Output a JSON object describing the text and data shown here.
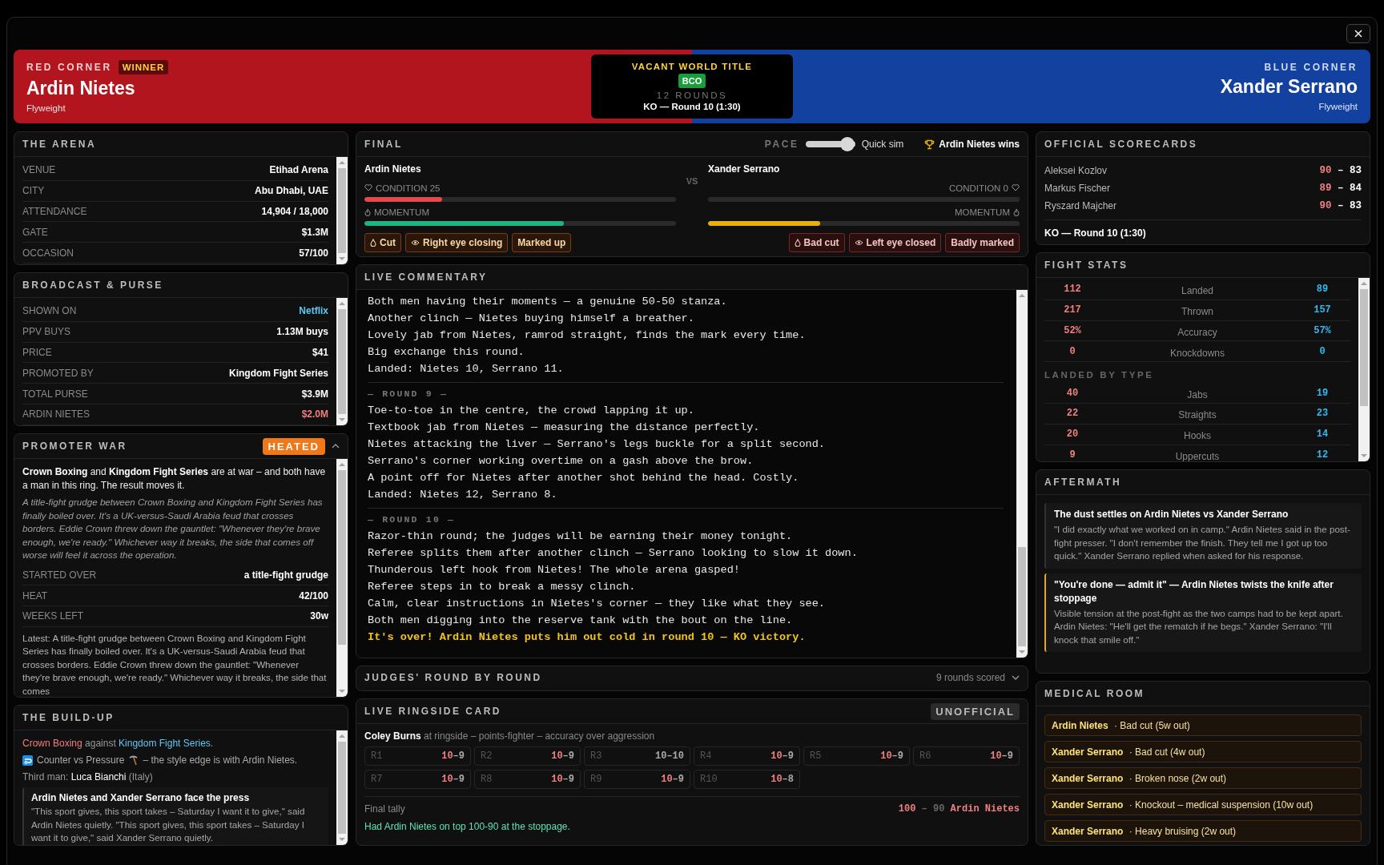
{
  "banner": {
    "red_corner": {
      "label": "RED CORNER",
      "badge": "WINNER",
      "name": "Ardin Nietes",
      "division": "Flyweight"
    },
    "title_card": {
      "title": "VACANT WORLD TITLE",
      "belt": "BCO",
      "rounds": "12 ROUNDS",
      "result": "KO — Round 10 (1:30)"
    },
    "blue_corner": {
      "label": "BLUE CORNER",
      "name": "Xander Serrano",
      "division": "Flyweight"
    }
  },
  "arena": {
    "title": "THE ARENA",
    "rows": [
      {
        "label": "VENUE",
        "value": "Etihad Arena"
      },
      {
        "label": "CITY",
        "value": "Abu Dhabi, UAE"
      },
      {
        "label": "ATTENDANCE",
        "value": "14,904 / 18,000"
      },
      {
        "label": "GATE",
        "value": "$1.3M"
      },
      {
        "label": "OCCASION",
        "value": "57/100"
      }
    ]
  },
  "broadcast": {
    "title": "BROADCAST & PURSE",
    "rows": [
      {
        "label": "SHOWN ON",
        "value": "Netflix",
        "kind": "link"
      },
      {
        "label": "PPV BUYS",
        "value": "1.13M buys",
        "kind": "plain"
      },
      {
        "label": "PRICE",
        "value": "$41",
        "kind": "plain"
      },
      {
        "label": "PROMOTED BY",
        "value": "Kingdom Fight Series",
        "kind": "plain"
      },
      {
        "label": "TOTAL PURSE",
        "value": "$3.9M",
        "kind": "plain"
      },
      {
        "label": "ARDIN NIETES",
        "value": "$2.0M",
        "kind": "red"
      }
    ]
  },
  "promoter_war": {
    "title": "PROMOTER WAR",
    "badge": "HEATED",
    "expanded": true,
    "intro": "**Crown Boxing** and **Kingdom Fight Series** are at war – and both have a man in this ring. The result moves it.",
    "story": "A title-fight grudge between Crown Boxing and Kingdom Fight Series has finally boiled over. It's a UK-versus-Saudi Arabia feud that crosses borders. Eddie Crown threw down the gauntlet: \"Whenever they're brave enough, we're ready.\" Whichever way it breaks, the side that comes off worse will feel it across the operation.",
    "rows": [
      {
        "label": "STARTED OVER",
        "value": "a title-fight grudge"
      },
      {
        "label": "HEAT",
        "value": "42/100"
      },
      {
        "label": "WEEKS LEFT",
        "value": "30w"
      }
    ],
    "latest": "Latest: A title-fight grudge between Crown Boxing and Kingdom Fight Series has finally boiled over. It's a UK-versus-Saudi Arabia feud that crosses borders. Eddie Crown threw down the gauntlet: \"Whenever they're brave enough, we're ready.\" Whichever way it breaks, the side that comes"
  },
  "build_up": {
    "title": "THE BUILD-UP",
    "rivalry": {
      "red": "Crown Boxing",
      "joiner": "against",
      "blue": "Kingdom Fight Series",
      "end": "."
    },
    "style_line": {
      "left": "Counter vs Pressure",
      "right": "– the style edge is with Ardin Nietes."
    },
    "third_man": "Third man: **Luca Bianchi** (Italy)",
    "press": {
      "title": "Ardin Nietes and Xander Serrano face the press",
      "text": "\"This sport gives, this sport takes – Saturday I want it to give,\" said Ardin Nietes quietly. \"This sport gives, this sport takes – Saturday I want it to give,\" said Xander Serrano quietly."
    }
  },
  "final": {
    "status": "FINAL",
    "pace": {
      "label": "PACE",
      "level": 1,
      "value": "Quick sim"
    },
    "winner": "Ardin Nietes wins",
    "vs": "VS",
    "fighters": [
      {
        "kind": "red",
        "name": "Ardin Nietes",
        "condition": {
          "label": "CONDITION 25",
          "level": 0.25
        },
        "momentum": {
          "label": "MOMENTUM",
          "level": 0.64,
          "color": "#1db584"
        },
        "tags": [
          {
            "label": "Cut",
            "kind": "cut"
          },
          {
            "label": "Right eye closing",
            "kind": "eye"
          },
          {
            "label": "Marked up",
            "kind": "mark"
          }
        ]
      },
      {
        "kind": "blue",
        "name": "Xander Serrano",
        "condition": {
          "label": "CONDITION 0",
          "level": 0
        },
        "momentum": {
          "label": "MOMENTUM",
          "level": 0.36,
          "color": "#e9b10f"
        },
        "tags": [
          {
            "label": "Bad cut",
            "kind": "cut"
          },
          {
            "label": "Left eye closed",
            "kind": "eye"
          },
          {
            "label": "Badly marked",
            "kind": "mark"
          }
        ]
      }
    ]
  },
  "commentary": {
    "title": "LIVE COMMENTARY",
    "sections": [
      {
        "lines": [
          {
            "text": "Both men having their moments — a genuine 50-50 stanza.",
            "kind": "normal"
          },
          {
            "text": "Another clinch — Nietes buying himself a breather.",
            "kind": "normal"
          },
          {
            "text": "Lovely jab from Nietes, ramrod straight, finds the mark every time.",
            "kind": "normal"
          },
          {
            "text": "Big exchange this round.",
            "kind": "normal"
          },
          {
            "text": "Landed: Nietes 10, Serrano 11.",
            "kind": "normal"
          }
        ]
      },
      {
        "heading": "— ROUND 9 —",
        "lines": [
          {
            "text": "Toe-to-toe in the centre, the crowd lapping it up.",
            "kind": "normal"
          },
          {
            "text": "Textbook jab from Nietes — measuring the distance perfectly.",
            "kind": "normal"
          },
          {
            "text": "Nietes attacking the liver — Serrano's legs buckle for a split second.",
            "kind": "normal"
          },
          {
            "text": "Serrano's corner working overtime on a gash above the brow.",
            "kind": "normal"
          },
          {
            "text": "A point off for Nietes after another shot behind the head. Costly.",
            "kind": "normal"
          },
          {
            "text": "Landed: Nietes 12, Serrano 8.",
            "kind": "normal"
          }
        ]
      },
      {
        "heading": "— ROUND 10 —",
        "lines": [
          {
            "text": "Razor-thin round; the judges will be earning their money tonight.",
            "kind": "normal"
          },
          {
            "text": "Referee splits them after another clinch — Serrano looking to slow it down.",
            "kind": "normal"
          },
          {
            "text": "Thunderous left hook from Nietes! The whole arena gasped!",
            "kind": "normal"
          },
          {
            "text": "Referee steps in to break a messy clinch.",
            "kind": "normal"
          },
          {
            "text": "Calm, clear instructions in Nietes's corner — they like what they see.",
            "kind": "normal"
          },
          {
            "text": "Both men digging into the reserve tank with the bout on the line.",
            "kind": "normal"
          },
          {
            "text": "It's over! Ardin Nietes puts him out cold in round 10 — KO victory.",
            "kind": "finish"
          }
        ]
      }
    ]
  },
  "judges": {
    "title": "JUDGES' ROUND BY ROUND",
    "summary": "9 rounds scored",
    "expanded": false
  },
  "ringside_card": {
    "title": "LIVE RINGSIDE CARD",
    "badge": "UNOFFICIAL",
    "judge": "Coley Burns",
    "judge_note": "at ringside – points-fighter – accuracy over aggression",
    "rounds": [
      {
        "round": "R1",
        "red": "10",
        "dash": "–",
        "blue": "9",
        "kind": "won"
      },
      {
        "round": "R2",
        "red": "10",
        "dash": "–",
        "blue": "9",
        "kind": "won"
      },
      {
        "round": "R3",
        "red": "10",
        "dash": "–",
        "blue": "10",
        "kind": "even"
      },
      {
        "round": "R4",
        "red": "10",
        "dash": "–",
        "blue": "9",
        "kind": "won"
      },
      {
        "round": "R5",
        "red": "10",
        "dash": "–",
        "blue": "9",
        "kind": "won"
      },
      {
        "round": "R6",
        "red": "10",
        "dash": "–",
        "blue": "9",
        "kind": "won"
      },
      {
        "round": "R7",
        "red": "10",
        "dash": "–",
        "blue": "9",
        "kind": "won"
      },
      {
        "round": "R8",
        "red": "10",
        "dash": "–",
        "blue": "9",
        "kind": "won"
      },
      {
        "round": "R9",
        "red": "10",
        "dash": "–",
        "blue": "9",
        "kind": "won"
      },
      {
        "round": "R10",
        "red": "10",
        "dash": "–",
        "blue": "8",
        "kind": "won"
      }
    ],
    "tally": {
      "label": "Final tally",
      "red": "100",
      "dash": "–",
      "blue": "90",
      "winner": "Ardin Nietes"
    },
    "note": "Had Ardin Nietes on top 100-90 at the stoppage."
  },
  "scorecards": {
    "title": "OFFICIAL SCORECARDS",
    "judges": [
      {
        "name": "Aleksei Kozlov",
        "red": "90",
        "dash": "–",
        "blue": "83"
      },
      {
        "name": "Markus Fischer",
        "red": "89",
        "dash": "–",
        "blue": "84"
      },
      {
        "name": "Ryszard Majcher",
        "red": "90",
        "dash": "–",
        "blue": "83"
      }
    ],
    "result": "KO — Round 10 (1:30)"
  },
  "fight_stats": {
    "title": "FIGHT STATS",
    "rows": [
      {
        "red": "112",
        "label": "Landed",
        "blue": "89"
      },
      {
        "red": "217",
        "label": "Thrown",
        "blue": "157"
      },
      {
        "red": "52%",
        "label": "Accuracy",
        "blue": "57%"
      },
      {
        "red": "0",
        "label": "Knockdowns",
        "blue": "0"
      }
    ],
    "section": "LANDED BY TYPE",
    "type_rows": [
      {
        "red": "40",
        "label": "Jabs",
        "blue": "19"
      },
      {
        "red": "22",
        "label": "Straights",
        "blue": "23"
      },
      {
        "red": "20",
        "label": "Hooks",
        "blue": "14"
      },
      {
        "red": "9",
        "label": "Uppercuts",
        "blue": "12"
      }
    ]
  },
  "aftermath": {
    "title": "AFTERMATH",
    "items": [
      {
        "title": "The dust settles on Ardin Nietes vs Xander Serrano",
        "text": "\"I did exactly what we worked on in camp.\" Ardin Nietes said in the post-fight presser. \"I don't remember the finish. They tell me I got up too quick.\" Xander Serrano replied when asked for his response.",
        "kind": "neutral"
      },
      {
        "title": "\"You're done — admit it\" — Ardin Nietes twists the knife after stoppage",
        "text": "Visible tension at the post-fight as the two camps had to be kept apart. Ardin Nietes: \"He'll get the rematch if he begs.\" Xander Serrano: \"I'll knock that smile off.\"",
        "kind": "heated"
      }
    ]
  },
  "medical": {
    "title": "MEDICAL ROOM",
    "items": [
      {
        "text": "**Ardin Nietes** · Bad cut (5w out)"
      },
      {
        "text": "**Xander Serrano** · Bad cut (4w out)"
      },
      {
        "text": "**Xander Serrano** · Broken nose (2w out)"
      },
      {
        "text": "**Xander Serrano** · Knockout – medical suspension (10w out)"
      },
      {
        "text": "**Xander Serrano** · Heavy bruising (2w out)"
      }
    ]
  }
}
